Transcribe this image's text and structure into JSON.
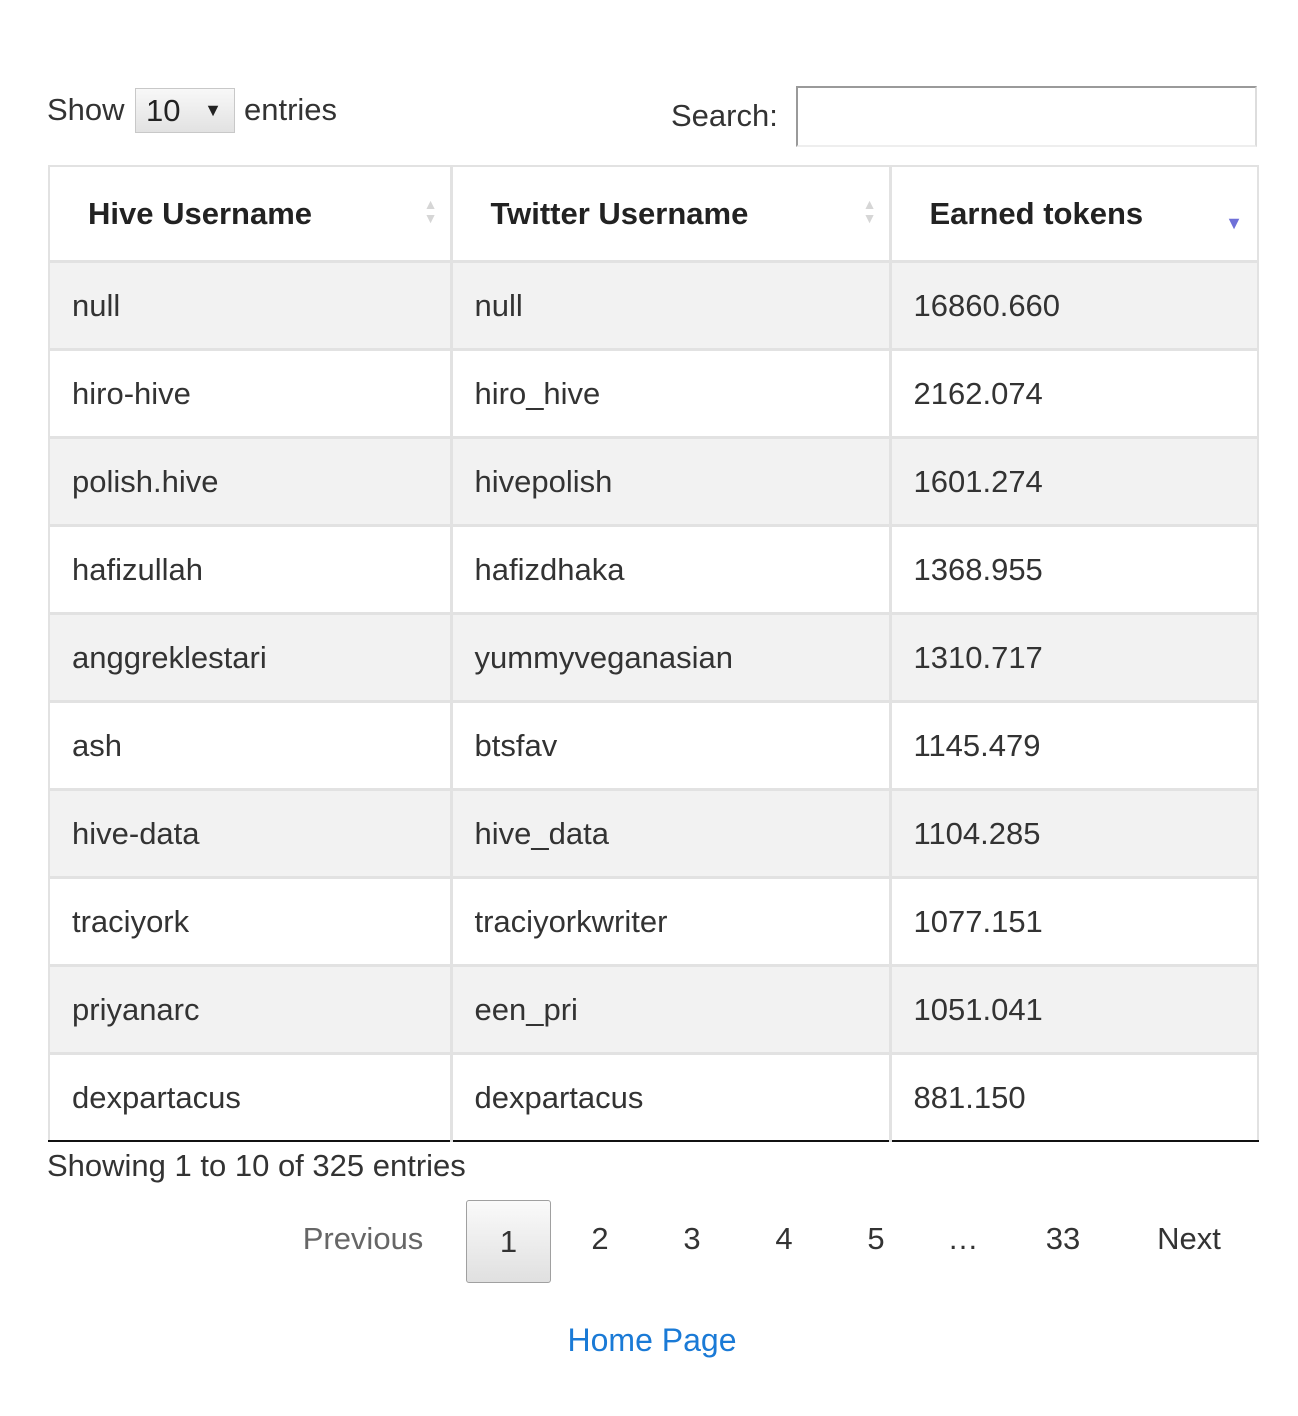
{
  "controls": {
    "show_label": "Show",
    "length_value": "10",
    "entries_label": "entries",
    "search_label": "Search:",
    "search_value": ""
  },
  "table": {
    "columns": [
      "Hive Username",
      "Twitter Username",
      "Earned tokens"
    ],
    "sort": {
      "column": "Earned tokens",
      "direction": "descending",
      "indicator_color": "#6f70d8"
    },
    "rows": [
      [
        "null",
        "null",
        "16860.660"
      ],
      [
        "hiro-hive",
        "hiro_hive",
        "2162.074"
      ],
      [
        "polish.hive",
        "hivepolish",
        "1601.274"
      ],
      [
        "hafizullah",
        "hafizdhaka",
        "1368.955"
      ],
      [
        "anggreklestari",
        "yummyveganasian",
        "1310.717"
      ],
      [
        "ash",
        "btsfav",
        "1145.479"
      ],
      [
        "hive-data",
        "hive_data",
        "1104.285"
      ],
      [
        "traciyork",
        "traciyorkwriter",
        "1077.151"
      ],
      [
        "priyanarc",
        "een_pri",
        "1051.041"
      ],
      [
        "dexpartacus",
        "dexpartacus",
        "881.150"
      ]
    ]
  },
  "info": "Showing 1 to 10 of 325 entries",
  "pagination": {
    "previous": "Previous",
    "current": "1",
    "pages": [
      "2",
      "3",
      "4",
      "5",
      "…",
      "33"
    ],
    "next": "Next"
  },
  "footer": {
    "home_link": "Home Page",
    "link_color": "#1a7ad6"
  }
}
